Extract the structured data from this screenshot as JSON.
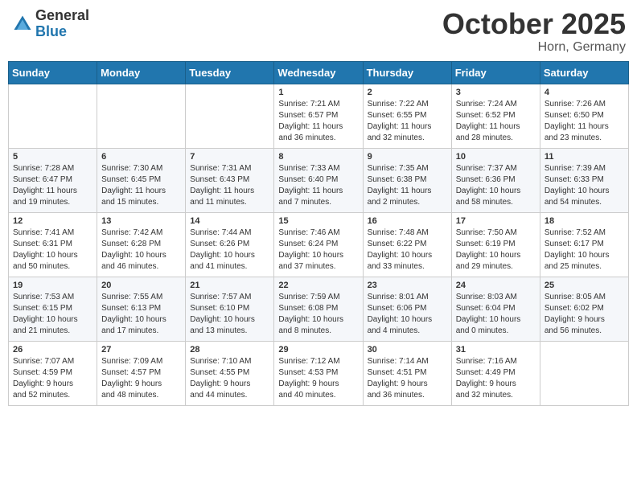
{
  "header": {
    "logo": {
      "general": "General",
      "blue": "Blue"
    },
    "title": "October 2025",
    "location": "Horn, Germany"
  },
  "calendar": {
    "days_of_week": [
      "Sunday",
      "Monday",
      "Tuesday",
      "Wednesday",
      "Thursday",
      "Friday",
      "Saturday"
    ],
    "weeks": [
      [
        {
          "day": "",
          "info": ""
        },
        {
          "day": "",
          "info": ""
        },
        {
          "day": "",
          "info": ""
        },
        {
          "day": "1",
          "info": "Sunrise: 7:21 AM\nSunset: 6:57 PM\nDaylight: 11 hours\nand 36 minutes."
        },
        {
          "day": "2",
          "info": "Sunrise: 7:22 AM\nSunset: 6:55 PM\nDaylight: 11 hours\nand 32 minutes."
        },
        {
          "day": "3",
          "info": "Sunrise: 7:24 AM\nSunset: 6:52 PM\nDaylight: 11 hours\nand 28 minutes."
        },
        {
          "day": "4",
          "info": "Sunrise: 7:26 AM\nSunset: 6:50 PM\nDaylight: 11 hours\nand 23 minutes."
        }
      ],
      [
        {
          "day": "5",
          "info": "Sunrise: 7:28 AM\nSunset: 6:47 PM\nDaylight: 11 hours\nand 19 minutes."
        },
        {
          "day": "6",
          "info": "Sunrise: 7:30 AM\nSunset: 6:45 PM\nDaylight: 11 hours\nand 15 minutes."
        },
        {
          "day": "7",
          "info": "Sunrise: 7:31 AM\nSunset: 6:43 PM\nDaylight: 11 hours\nand 11 minutes."
        },
        {
          "day": "8",
          "info": "Sunrise: 7:33 AM\nSunset: 6:40 PM\nDaylight: 11 hours\nand 7 minutes."
        },
        {
          "day": "9",
          "info": "Sunrise: 7:35 AM\nSunset: 6:38 PM\nDaylight: 11 hours\nand 2 minutes."
        },
        {
          "day": "10",
          "info": "Sunrise: 7:37 AM\nSunset: 6:36 PM\nDaylight: 10 hours\nand 58 minutes."
        },
        {
          "day": "11",
          "info": "Sunrise: 7:39 AM\nSunset: 6:33 PM\nDaylight: 10 hours\nand 54 minutes."
        }
      ],
      [
        {
          "day": "12",
          "info": "Sunrise: 7:41 AM\nSunset: 6:31 PM\nDaylight: 10 hours\nand 50 minutes."
        },
        {
          "day": "13",
          "info": "Sunrise: 7:42 AM\nSunset: 6:28 PM\nDaylight: 10 hours\nand 46 minutes."
        },
        {
          "day": "14",
          "info": "Sunrise: 7:44 AM\nSunset: 6:26 PM\nDaylight: 10 hours\nand 41 minutes."
        },
        {
          "day": "15",
          "info": "Sunrise: 7:46 AM\nSunset: 6:24 PM\nDaylight: 10 hours\nand 37 minutes."
        },
        {
          "day": "16",
          "info": "Sunrise: 7:48 AM\nSunset: 6:22 PM\nDaylight: 10 hours\nand 33 minutes."
        },
        {
          "day": "17",
          "info": "Sunrise: 7:50 AM\nSunset: 6:19 PM\nDaylight: 10 hours\nand 29 minutes."
        },
        {
          "day": "18",
          "info": "Sunrise: 7:52 AM\nSunset: 6:17 PM\nDaylight: 10 hours\nand 25 minutes."
        }
      ],
      [
        {
          "day": "19",
          "info": "Sunrise: 7:53 AM\nSunset: 6:15 PM\nDaylight: 10 hours\nand 21 minutes."
        },
        {
          "day": "20",
          "info": "Sunrise: 7:55 AM\nSunset: 6:13 PM\nDaylight: 10 hours\nand 17 minutes."
        },
        {
          "day": "21",
          "info": "Sunrise: 7:57 AM\nSunset: 6:10 PM\nDaylight: 10 hours\nand 13 minutes."
        },
        {
          "day": "22",
          "info": "Sunrise: 7:59 AM\nSunset: 6:08 PM\nDaylight: 10 hours\nand 8 minutes."
        },
        {
          "day": "23",
          "info": "Sunrise: 8:01 AM\nSunset: 6:06 PM\nDaylight: 10 hours\nand 4 minutes."
        },
        {
          "day": "24",
          "info": "Sunrise: 8:03 AM\nSunset: 6:04 PM\nDaylight: 10 hours\nand 0 minutes."
        },
        {
          "day": "25",
          "info": "Sunrise: 8:05 AM\nSunset: 6:02 PM\nDaylight: 9 hours\nand 56 minutes."
        }
      ],
      [
        {
          "day": "26",
          "info": "Sunrise: 7:07 AM\nSunset: 4:59 PM\nDaylight: 9 hours\nand 52 minutes."
        },
        {
          "day": "27",
          "info": "Sunrise: 7:09 AM\nSunset: 4:57 PM\nDaylight: 9 hours\nand 48 minutes."
        },
        {
          "day": "28",
          "info": "Sunrise: 7:10 AM\nSunset: 4:55 PM\nDaylight: 9 hours\nand 44 minutes."
        },
        {
          "day": "29",
          "info": "Sunrise: 7:12 AM\nSunset: 4:53 PM\nDaylight: 9 hours\nand 40 minutes."
        },
        {
          "day": "30",
          "info": "Sunrise: 7:14 AM\nSunset: 4:51 PM\nDaylight: 9 hours\nand 36 minutes."
        },
        {
          "day": "31",
          "info": "Sunrise: 7:16 AM\nSunset: 4:49 PM\nDaylight: 9 hours\nand 32 minutes."
        },
        {
          "day": "",
          "info": ""
        }
      ]
    ]
  }
}
